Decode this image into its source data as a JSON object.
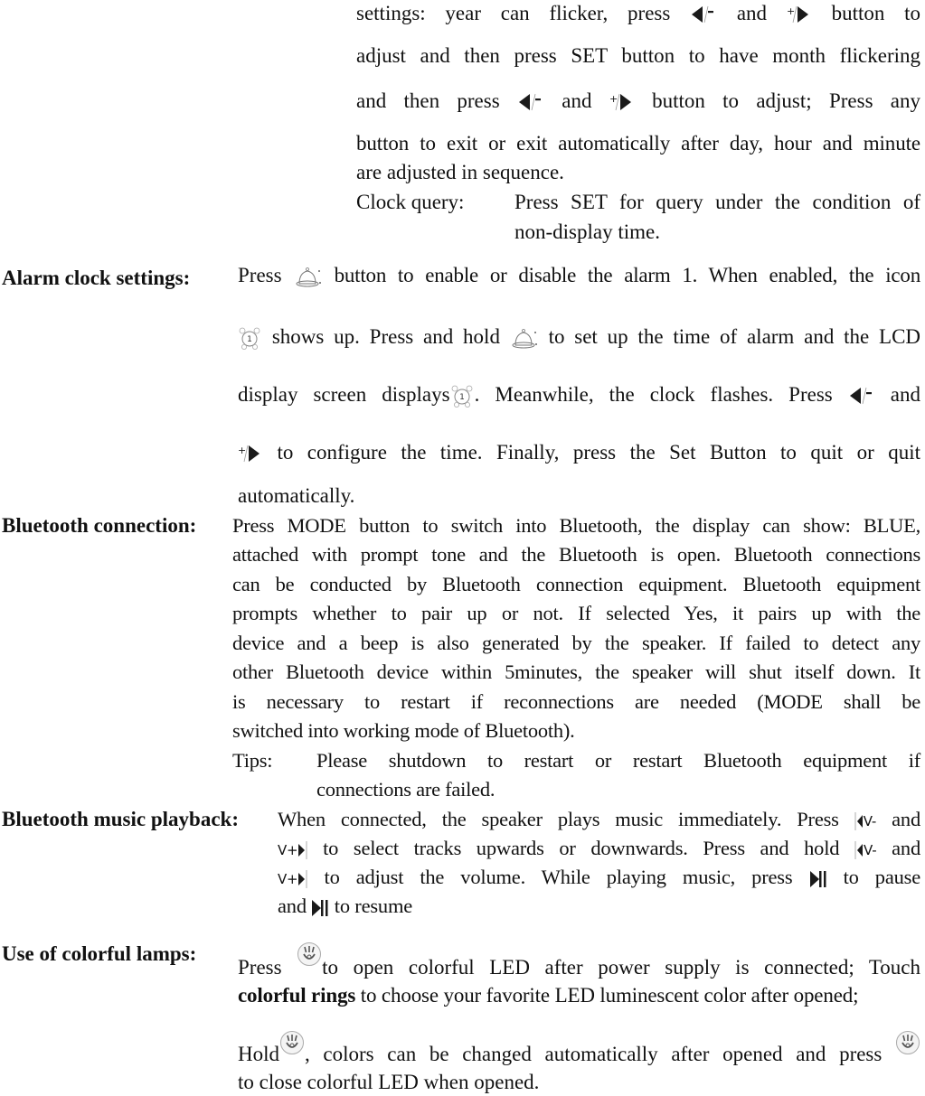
{
  "date_settings": {
    "line1_a": "settings: year can flicker, press",
    "line1_b": "and",
    "line1_c": "button to",
    "line2": "adjust and then press SET button to have month flickering",
    "line3_a": "and then press",
    "line3_b": "and",
    "line3_c": "button to adjust; Press any",
    "line4": "button to exit or exit automatically after day, hour and minute",
    "line5": "are adjusted in sequence."
  },
  "clock_query": {
    "label": "Clock query:",
    "line1": "Press SET for query under the condition of",
    "line2": "non-display time."
  },
  "alarm": {
    "label": "Alarm clock settings:",
    "line1_a": "Press",
    "line1_b": "button to enable or disable the alarm 1. When enabled, the icon",
    "line2_a": "shows up. Press and hold",
    "line2_b": "to set up the time of alarm and the LCD",
    "line3_a": "display screen displays",
    "line3_b": ". Meanwhile, the clock flashes. Press",
    "line3_c": "and",
    "line4": "to configure the time. Finally, press the Set Button to quit or quit",
    "line5": "automatically.",
    "alarm_number": "1"
  },
  "bluetooth_connection": {
    "label": "Bluetooth connection:",
    "lines": [
      "Press MODE button to switch into Bluetooth, the display can show: BLUE,",
      "attached with prompt tone and the Bluetooth is open. Bluetooth connections",
      "can be conducted by Bluetooth connection equipment. Bluetooth equipment",
      "prompts whether to pair up or not. If selected Yes, it pairs up with the",
      "device and a beep is also generated by the speaker. If failed to detect any",
      "other Bluetooth device within 5minutes, the speaker will shut itself down. It",
      "is necessary to restart if reconnections are needed (MODE shall be",
      "switched into working mode of Bluetooth)."
    ],
    "tips_label": "Tips:",
    "tips_line1": "Please shutdown to restart or restart Bluetooth equipment if",
    "tips_line2": "connections are failed."
  },
  "bluetooth_music": {
    "label": "Bluetooth music playback:",
    "line1_a": "When connected, the speaker plays music immediately. Press",
    "line1_b": "and",
    "line2_a": "to select tracks upwards or downwards. Press and hold",
    "line2_b": "and",
    "line3_a": "to adjust the volume. While playing music, press",
    "line3_b": "to pause",
    "line4_a": "and",
    "line4_b": "to resume",
    "vol_down_text": "V-",
    "vol_up_text": "V+"
  },
  "colorful_lamps": {
    "label": "Use of colorful lamps:",
    "line1_a": "Press",
    "line1_b": "to open colorful LED after power supply is connected; Touch",
    "line2_bold": "colorful rings",
    "line2_rest": " to choose your favorite LED luminescent color after opened;",
    "line3_a": "Hold",
    "line3_b": ", colors can be changed automatically after opened and press",
    "line4": "to close colorful LED when opened."
  }
}
